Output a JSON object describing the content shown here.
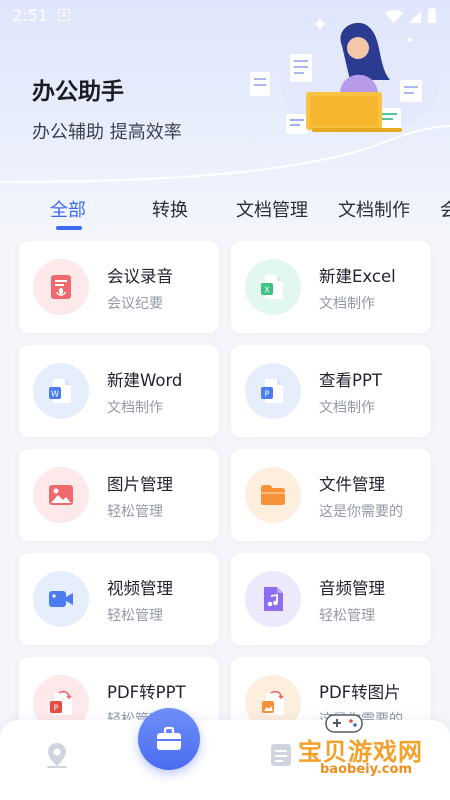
{
  "status": {
    "time": "2:51",
    "indicator": "A"
  },
  "header": {
    "title": "办公助手",
    "subtitle": "办公辅助  提高效率"
  },
  "tabs": [
    "全部",
    "转换",
    "文档管理",
    "文档制作",
    "会"
  ],
  "active_tab": 0,
  "tools": [
    {
      "title": "会议录音",
      "sub": "会议纪要",
      "icon": "microphone-doc-icon",
      "color": "red"
    },
    {
      "title": "新建Excel",
      "sub": "文档制作",
      "icon": "excel-doc-icon",
      "color": "green"
    },
    {
      "title": "新建Word",
      "sub": "文档制作",
      "icon": "word-doc-icon",
      "color": "blue"
    },
    {
      "title": "查看PPT",
      "sub": "文档制作",
      "icon": "ppt-doc-icon",
      "color": "blue"
    },
    {
      "title": "图片管理",
      "sub": "轻松管理",
      "icon": "image-icon",
      "color": "red"
    },
    {
      "title": "文件管理",
      "sub": "这是你需要的",
      "icon": "folder-icon",
      "color": "orange"
    },
    {
      "title": "视频管理",
      "sub": "轻松管理",
      "icon": "video-camera-icon",
      "color": "blue"
    },
    {
      "title": "音频管理",
      "sub": "轻松管理",
      "icon": "music-file-icon",
      "color": "purple"
    },
    {
      "title": "PDF转PPT",
      "sub": "轻松管理",
      "icon": "pdf-to-ppt-icon",
      "color": "red"
    },
    {
      "title": "PDF转图片",
      "sub": "这是你需要的",
      "icon": "pdf-to-image-icon",
      "color": "orange"
    }
  ],
  "bottom_nav": {
    "left_icon": "map-pin-icon",
    "center_icon": "briefcase-icon",
    "right_icon": "document-list-icon"
  },
  "watermark": {
    "title": "宝贝游戏网",
    "url": "baobeiy.com"
  },
  "colors": {
    "accent": "#3e6af2",
    "background": "#f4f6fb"
  }
}
